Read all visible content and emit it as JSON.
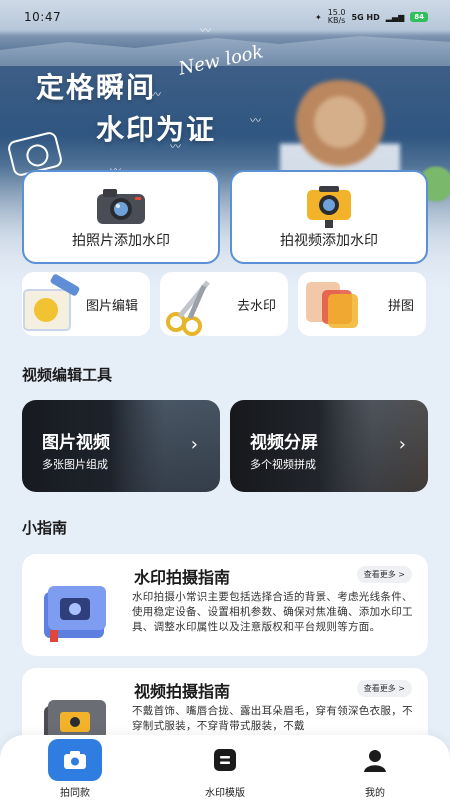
{
  "status_bar": {
    "time": "10:47",
    "net_speed": "15.0\nKB/s",
    "signal": "5G HD",
    "battery": "84"
  },
  "hero": {
    "title_line1": "定格瞬间",
    "title_line2": "水印为证",
    "script_text": "New look"
  },
  "main_actions": {
    "photo_watermark": "拍照片添加水印",
    "video_watermark": "拍视频添加水印"
  },
  "quick_tools": {
    "image_edit": "图片编辑",
    "remove_watermark": "去水印",
    "collage": "拼图"
  },
  "video_tools": {
    "section_title": "视频编辑工具",
    "items": [
      {
        "title": "图片视频",
        "subtitle": "多张图片组成"
      },
      {
        "title": "视频分屏",
        "subtitle": "多个视频拼成"
      }
    ]
  },
  "guide": {
    "section_title": "小指南",
    "more_label": "查看更多 >",
    "items": [
      {
        "title": "水印拍摄指南",
        "body": "水印拍摄小常识主要包括选择合适的背景、考虑光线条件、使用稳定设备、设置相机参数、确保对焦准确、添加水印工具、调整水印属性以及注意版权和平台规则等方面。"
      },
      {
        "title": "视频拍摄指南",
        "body": "不戴首饰、嘴唇合拢、露出耳朵眉毛，穿有领深色衣服，不穿制式服装，不穿背带式服装，不戴"
      }
    ]
  },
  "bottom_nav": {
    "items": [
      {
        "label": "拍同款",
        "icon": "camera-icon",
        "active": true
      },
      {
        "label": "水印模版",
        "icon": "template-icon",
        "active": false
      },
      {
        "label": "我的",
        "icon": "user-icon",
        "active": false
      }
    ]
  },
  "colors": {
    "accent": "#2f7de1",
    "card_border": "#5b8fd6",
    "page_bg": "#e6eef8"
  }
}
